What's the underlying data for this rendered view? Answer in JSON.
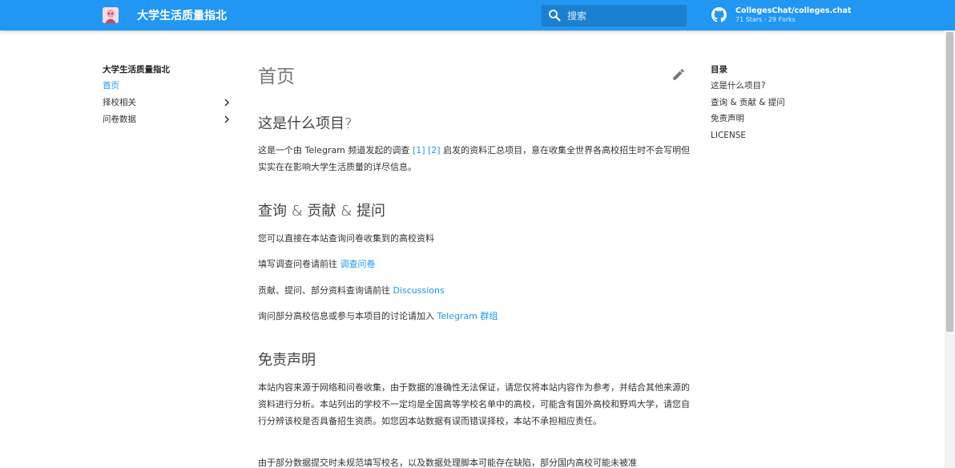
{
  "header": {
    "site_title": "大学生活质量指北",
    "search_placeholder": "搜索",
    "repo_name": "CollegesChat/colleges.chat",
    "repo_stats": "71 Stars · 29 Forks"
  },
  "sidebar": {
    "title": "大学生活质量指北",
    "items": [
      {
        "label": "首页"
      },
      {
        "label": "择校相关"
      },
      {
        "label": "问卷数据"
      }
    ]
  },
  "toc": {
    "title": "目录",
    "items": [
      {
        "label": "这是什么项目?"
      },
      {
        "label": "查询 & 贡献 & 提问"
      },
      {
        "label": "免责声明"
      },
      {
        "label": "LICENSE"
      }
    ]
  },
  "content": {
    "page_title": "首页",
    "s1": {
      "heading": "这是什么项目?",
      "p_text_a": "这是一个由 Telegram 频道发起的调查 ",
      "ref1": "[1]",
      "ref2": "[2]",
      "p_text_b": " 启发的资料汇总项目，意在收集全世界各高校招生时不会写明但实实在在影响大学生活质量的详尽信息。"
    },
    "s2": {
      "heading": "查询 & 贡献 & 提问",
      "p1": "您可以直接在本站查询问卷收集到的高校资料",
      "p2_text": "填写调查问卷请前往 ",
      "p2_link": "调查问卷",
      "p3_text": "贡献、提问、部分资料查询请前往 ",
      "p3_link": "Discussions",
      "p4_text": "询问部分高校信息或参与本项目的讨论请加入 ",
      "p4_link": "Telegram 群组"
    },
    "s3": {
      "heading": "免责声明",
      "p1": "本站内容来源于网络和问卷收集，由于数据的准确性无法保证，请您仅将本站内容作为参考，并结合其他来源的资料进行分析。本站列出的学校不一定均是全国高等学校名单中的高校，可能含有国外高校和野鸡大学，请您自行分辨该校是否具备招生资质。如您因本站数据有误而错误择校，本站不承担相应责任。",
      "p2": "由于部分数据提交时未规范填写校名，以及数据处理脚本可能存在缺陷，部分国内高校可能未被准"
    }
  },
  "colors": {
    "primary": "#2196f3",
    "text": "#333333"
  }
}
